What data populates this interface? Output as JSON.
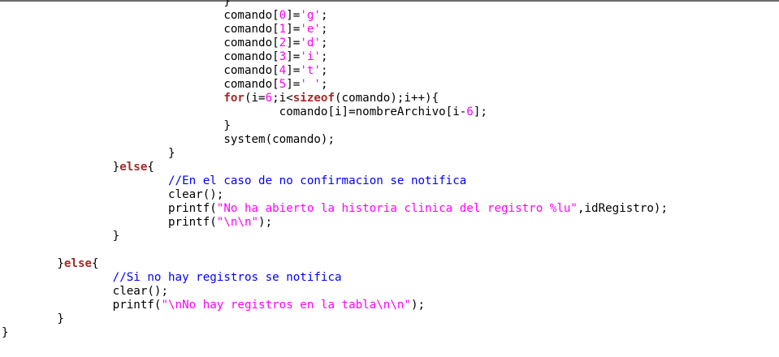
{
  "colors": {
    "background": "#ffffff",
    "text": "#000000",
    "keyword": "#a52a2a",
    "literal": "#ff00ff",
    "comment": "#0000ff",
    "top_border": "#6b6b6b"
  },
  "code": {
    "lines": [
      [
        {
          "t": "plain",
          "v": "\t\t\t\t}"
        }
      ],
      [
        {
          "t": "plain",
          "v": "\t\t\t\tcomando["
        },
        {
          "t": "num",
          "v": "0"
        },
        {
          "t": "plain",
          "v": "]="
        },
        {
          "t": "str",
          "v": "'g'"
        },
        {
          "t": "plain",
          "v": ";"
        }
      ],
      [
        {
          "t": "plain",
          "v": "\t\t\t\tcomando["
        },
        {
          "t": "num",
          "v": "1"
        },
        {
          "t": "plain",
          "v": "]="
        },
        {
          "t": "str",
          "v": "'e'"
        },
        {
          "t": "plain",
          "v": ";"
        }
      ],
      [
        {
          "t": "plain",
          "v": "\t\t\t\tcomando["
        },
        {
          "t": "num",
          "v": "2"
        },
        {
          "t": "plain",
          "v": "]="
        },
        {
          "t": "str",
          "v": "'d'"
        },
        {
          "t": "plain",
          "v": ";"
        }
      ],
      [
        {
          "t": "plain",
          "v": "\t\t\t\tcomando["
        },
        {
          "t": "num",
          "v": "3"
        },
        {
          "t": "plain",
          "v": "]="
        },
        {
          "t": "str",
          "v": "'i'"
        },
        {
          "t": "plain",
          "v": ";"
        }
      ],
      [
        {
          "t": "plain",
          "v": "\t\t\t\tcomando["
        },
        {
          "t": "num",
          "v": "4"
        },
        {
          "t": "plain",
          "v": "]="
        },
        {
          "t": "str",
          "v": "'t'"
        },
        {
          "t": "plain",
          "v": ";"
        }
      ],
      [
        {
          "t": "plain",
          "v": "\t\t\t\tcomando["
        },
        {
          "t": "num",
          "v": "5"
        },
        {
          "t": "plain",
          "v": "]="
        },
        {
          "t": "str",
          "v": "' '"
        },
        {
          "t": "plain",
          "v": ";"
        }
      ],
      [
        {
          "t": "plain",
          "v": "\t\t\t\t"
        },
        {
          "t": "kw",
          "v": "for"
        },
        {
          "t": "plain",
          "v": "(i="
        },
        {
          "t": "num",
          "v": "6"
        },
        {
          "t": "plain",
          "v": ";i<"
        },
        {
          "t": "kw",
          "v": "sizeof"
        },
        {
          "t": "plain",
          "v": "(comando);i++){"
        }
      ],
      [
        {
          "t": "plain",
          "v": "\t\t\t\t\tcomando[i]=nombreArchivo[i-"
        },
        {
          "t": "num",
          "v": "6"
        },
        {
          "t": "plain",
          "v": "];"
        }
      ],
      [
        {
          "t": "plain",
          "v": "\t\t\t\t}"
        }
      ],
      [
        {
          "t": "plain",
          "v": "\t\t\t\tsystem(comando);"
        }
      ],
      [
        {
          "t": "plain",
          "v": "\t\t\t}"
        }
      ],
      [
        {
          "t": "plain",
          "v": "\t\t}"
        },
        {
          "t": "kw",
          "v": "else"
        },
        {
          "t": "plain",
          "v": "{"
        }
      ],
      [
        {
          "t": "plain",
          "v": "\t\t\t"
        },
        {
          "t": "com",
          "v": "//En el caso de no confirmacion se notifica"
        }
      ],
      [
        {
          "t": "plain",
          "v": "\t\t\tclear();"
        }
      ],
      [
        {
          "t": "plain",
          "v": "\t\t\tprintf("
        },
        {
          "t": "str",
          "v": "\"No ha abierto la historia clinica del registro %lu\""
        },
        {
          "t": "plain",
          "v": ",idRegistro);"
        }
      ],
      [
        {
          "t": "plain",
          "v": "\t\t\tprintf("
        },
        {
          "t": "str",
          "v": "\"\\n\\n\""
        },
        {
          "t": "plain",
          "v": ");"
        }
      ],
      [
        {
          "t": "plain",
          "v": "\t\t}"
        }
      ],
      [
        {
          "t": "plain",
          "v": ""
        }
      ],
      [
        {
          "t": "plain",
          "v": "\t}"
        },
        {
          "t": "kw",
          "v": "else"
        },
        {
          "t": "plain",
          "v": "{"
        }
      ],
      [
        {
          "t": "plain",
          "v": "\t\t"
        },
        {
          "t": "com",
          "v": "//Si no hay registros se notifica"
        }
      ],
      [
        {
          "t": "plain",
          "v": "\t\tclear();"
        }
      ],
      [
        {
          "t": "plain",
          "v": "\t\tprintf("
        },
        {
          "t": "str",
          "v": "\"\\nNo hay registros en la tabla\\n\\n\""
        },
        {
          "t": "plain",
          "v": ");"
        }
      ],
      [
        {
          "t": "plain",
          "v": "\t}"
        }
      ],
      [
        {
          "t": "plain",
          "v": "}"
        }
      ]
    ]
  }
}
